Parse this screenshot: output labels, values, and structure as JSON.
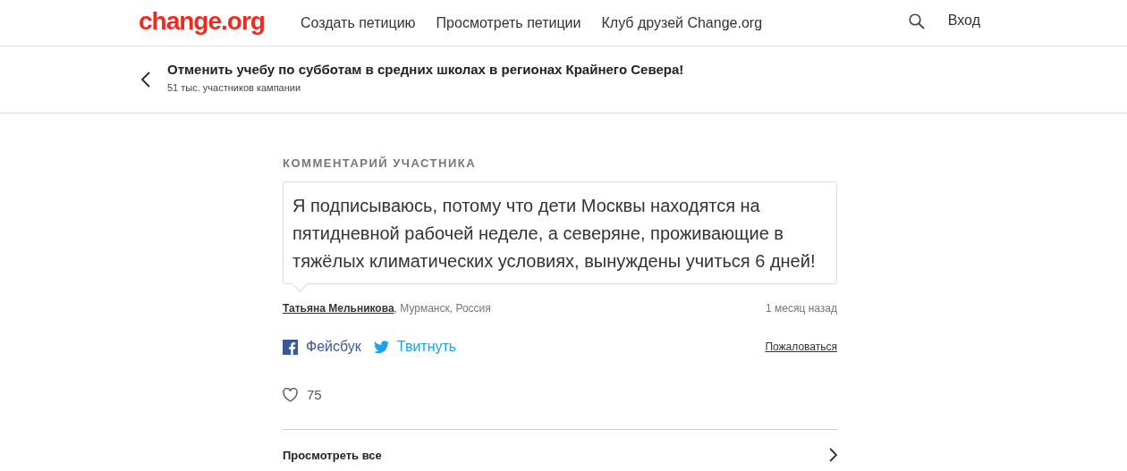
{
  "header": {
    "logo": "change.org",
    "nav": [
      "Создать петицию",
      "Просмотреть петиции",
      "Клуб друзей Change.org"
    ],
    "login": "Вход"
  },
  "petition": {
    "title": "Отменить учебу по субботам в средних школах в регионах Крайнего Севера!",
    "participants": "51 тыс. участников кампании"
  },
  "comment": {
    "heading": "КОММЕНТАРИЙ УЧАСТНИКА",
    "text": "Я подписываюсь, потому что дети Москвы находятся на пятидневной рабочей неделе, а северяне, проживающие в тяжёлых климатических условиях, вынуждены учиться 6 дней!",
    "author": "Татьяна Мельникова",
    "location": ", Мурманск, Россия",
    "time": "1 месяц назад"
  },
  "share": [
    {
      "kind": "facebook",
      "label": "Фейсбук"
    },
    {
      "kind": "twitter",
      "label": "Твитнуть"
    }
  ],
  "report": "Пожаловаться",
  "likes": "75",
  "view_all": "Просмотреть все"
}
